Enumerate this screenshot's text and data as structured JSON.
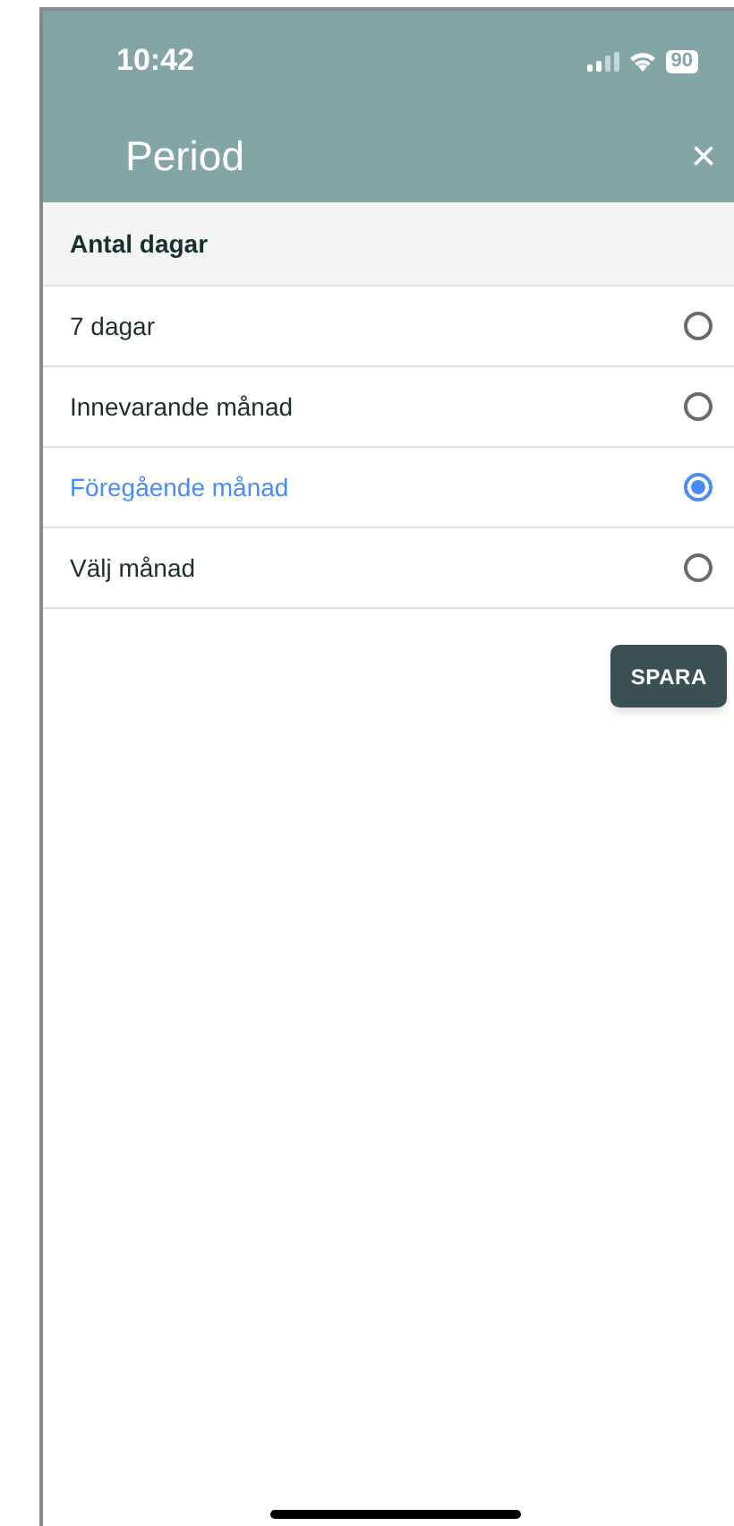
{
  "status_bar": {
    "time": "10:42",
    "battery": "90"
  },
  "header": {
    "title": "Period",
    "close": "×"
  },
  "section": {
    "title": "Antal dagar"
  },
  "options": [
    {
      "label": "7 dagar",
      "selected": false
    },
    {
      "label": "Innevarande månad",
      "selected": false
    },
    {
      "label": "Föregående månad",
      "selected": true
    },
    {
      "label": "Välj månad",
      "selected": false
    }
  ],
  "save_button": "SPARA"
}
